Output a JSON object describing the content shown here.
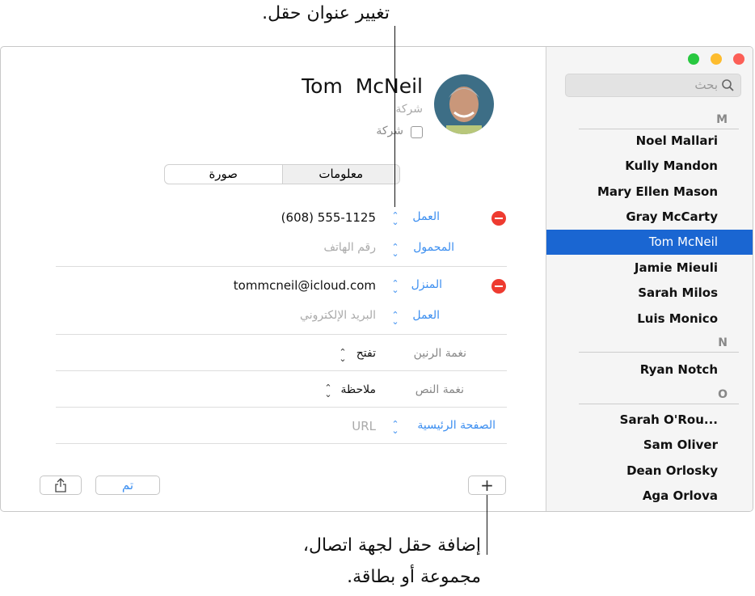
{
  "callouts": {
    "top": "تغيير عنوان حقل.",
    "bottom_line1": "إضافة حقل لجهة اتصال،",
    "bottom_line2": "مجموعة أو بطاقة."
  },
  "window": {
    "traffic_lights": {
      "close": "#fc5f57",
      "minimize": "#fdbc2e",
      "zoom": "#28c840"
    }
  },
  "sidebar": {
    "search_placeholder": "بحث",
    "sections": [
      {
        "letter": "M",
        "items": [
          "Noel Mallari",
          "Kully Mandon",
          "Mary Ellen Mason",
          "Gray McCarty",
          "Tom McNeil",
          "Jamie Mieuli",
          "Sarah Milos",
          "Luis Monico"
        ]
      },
      {
        "letter": "N",
        "items": [
          "Ryan Notch"
        ]
      },
      {
        "letter": "O",
        "items": [
          "Sarah O'Rou...",
          "Sam Oliver",
          "Dean Orlosky",
          "Aga Orlova"
        ]
      }
    ],
    "selected": "Tom McNeil",
    "selection_color": "#1a66d2"
  },
  "contact": {
    "name": "Tom  McNeil",
    "company_placeholder": "شركة",
    "company_checkbox_label": "شركة",
    "tabs": [
      "معلومات",
      "صورة"
    ],
    "phone": [
      {
        "label": "العمل",
        "value": "(608) 555-1125"
      },
      {
        "label": "المحمول",
        "placeholder": "رقم الهاتف"
      }
    ],
    "email": [
      {
        "label": "المنزل",
        "value": "tommcneil@icloud.com"
      },
      {
        "label": "العمل",
        "placeholder": "البريد الإلكتروني"
      }
    ],
    "ringtone": {
      "label": "نغمة الرنين",
      "value": "تفتح"
    },
    "texttone": {
      "label": "نغمة النص",
      "value": "ملاحظة"
    },
    "homepage": {
      "label": "الصفحة الرئيسية",
      "placeholder": "URL"
    }
  },
  "footer": {
    "add": "+",
    "done": "تم",
    "share_icon": "share-icon"
  },
  "accent": "#3b8ef0"
}
